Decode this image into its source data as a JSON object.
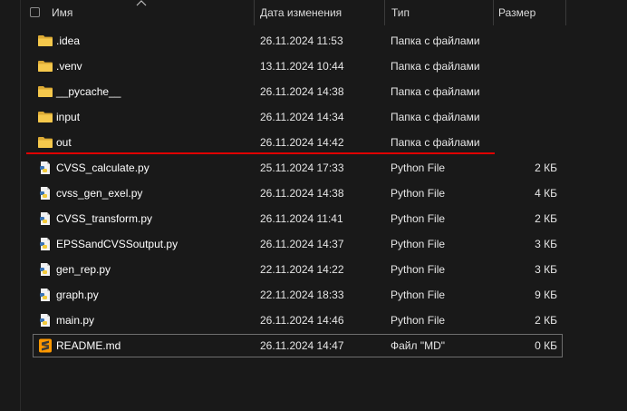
{
  "header": {
    "name_label": "Имя",
    "date_label": "Дата изменения",
    "type_label": "Тип",
    "size_label": "Размер"
  },
  "files": [
    {
      "name": ".idea",
      "date": "26.11.2024 11:53",
      "type": "Папка с файлами",
      "size": "",
      "icon": "folder-icon"
    },
    {
      "name": ".venv",
      "date": "13.11.2024 10:44",
      "type": "Папка с файлами",
      "size": "",
      "icon": "folder-icon"
    },
    {
      "name": "__pycache__",
      "date": "26.11.2024 14:38",
      "type": "Папка с файлами",
      "size": "",
      "icon": "folder-icon"
    },
    {
      "name": "input",
      "date": "26.11.2024 14:34",
      "type": "Папка с файлами",
      "size": "",
      "icon": "folder-icon"
    },
    {
      "name": "out",
      "date": "26.11.2024 14:42",
      "type": "Папка с файлами",
      "size": "",
      "icon": "folder-icon"
    },
    {
      "name": "CVSS_calculate.py",
      "date": "25.11.2024 17:33",
      "type": "Python File",
      "size": "2 КБ",
      "icon": "python-file-icon"
    },
    {
      "name": "cvss_gen_exel.py",
      "date": "26.11.2024 14:38",
      "type": "Python File",
      "size": "4 КБ",
      "icon": "python-file-icon"
    },
    {
      "name": "CVSS_transform.py",
      "date": "26.11.2024 11:41",
      "type": "Python File",
      "size": "2 КБ",
      "icon": "python-file-icon"
    },
    {
      "name": "EPSSandCVSSoutput.py",
      "date": "26.11.2024 14:37",
      "type": "Python File",
      "size": "3 КБ",
      "icon": "python-file-icon"
    },
    {
      "name": "gen_rep.py",
      "date": "22.11.2024 14:22",
      "type": "Python File",
      "size": "3 КБ",
      "icon": "python-file-icon"
    },
    {
      "name": "graph.py",
      "date": "22.11.2024 18:33",
      "type": "Python File",
      "size": "9 КБ",
      "icon": "python-file-icon"
    },
    {
      "name": "main.py",
      "date": "26.11.2024 14:46",
      "type": "Python File",
      "size": "2 КБ",
      "icon": "python-file-icon"
    },
    {
      "name": "README.md",
      "date": "26.11.2024 14:47",
      "type": "Файл \"MD\"",
      "size": "0 КБ",
      "icon": "sublime-text-file-icon",
      "selected": true
    }
  ],
  "annotation": {
    "color": "#e00000",
    "icon": "red-underline"
  }
}
